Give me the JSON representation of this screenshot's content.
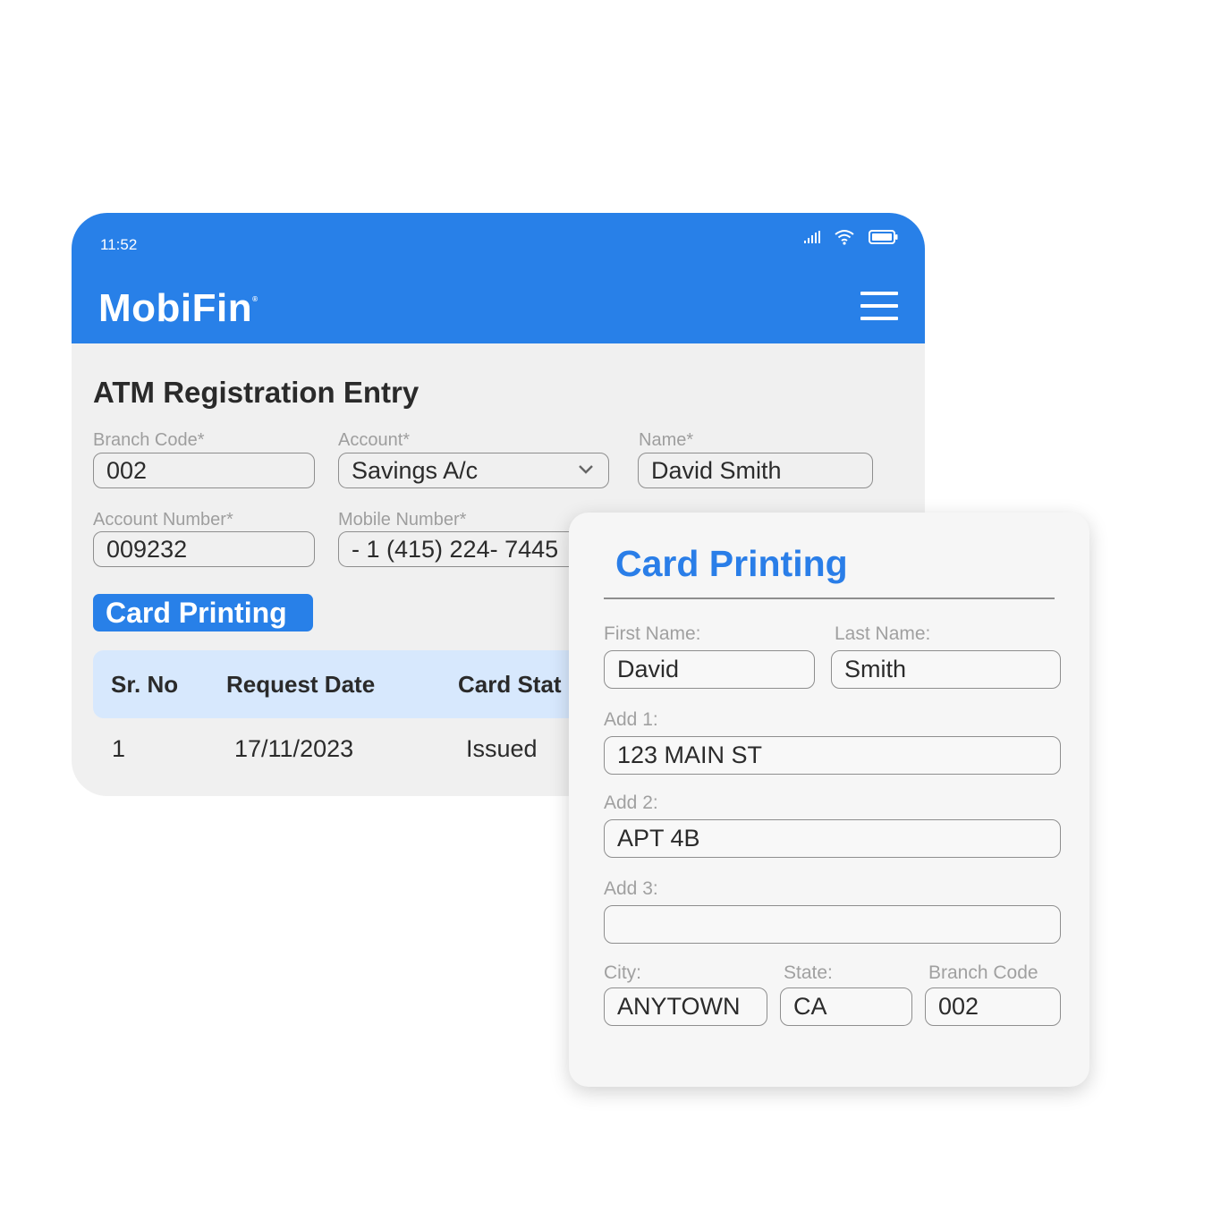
{
  "status_bar": {
    "time": "11:52",
    "icons": [
      "signal-icon",
      "wifi-icon",
      "battery-icon"
    ]
  },
  "header": {
    "logo": "MobiFin",
    "logo_mark": "®",
    "menu_icon": "hamburger-menu-icon"
  },
  "form": {
    "title": "ATM Registration Entry",
    "branch_code": {
      "label": "Branch  Code*",
      "value": "002"
    },
    "account": {
      "label": "Account*",
      "value": "Savings A/c"
    },
    "name": {
      "label": "Name*",
      "value": "David Smith"
    },
    "account_number": {
      "label": "Account Number*",
      "value": "009232"
    },
    "mobile_number": {
      "label": "Mobile Number*",
      "value": "- 1 (415) 224- 7445"
    }
  },
  "card_tab": {
    "label": "Card Printing"
  },
  "table": {
    "columns": [
      "Sr. No",
      "Request Date",
      "Card Stat"
    ],
    "rows": [
      {
        "sr_no": "1",
        "request_date": "17/11/2023",
        "card_status": "Issued"
      }
    ]
  },
  "card_printing": {
    "title": "Card Printing",
    "first_name": {
      "label": "First Name:",
      "value": "David"
    },
    "last_name": {
      "label": "Last Name:",
      "value": "Smith"
    },
    "add1": {
      "label": "Add 1:",
      "value": "123 MAIN ST"
    },
    "add2": {
      "label": "Add 2:",
      "value": "APT 4B"
    },
    "add3": {
      "label": "Add 3:",
      "value": ""
    },
    "city": {
      "label": "City:",
      "value": "ANYTOWN"
    },
    "state": {
      "label": "State:",
      "value": "CA"
    },
    "branch_code": {
      "label": "Branch Code",
      "value": "002"
    }
  },
  "colors": {
    "primary": "#2880e8",
    "table_header": "#d7e8fd",
    "background": "#f0f0f0"
  }
}
